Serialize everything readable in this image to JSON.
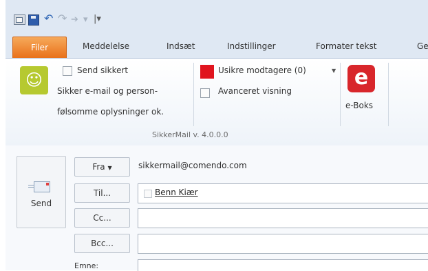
{
  "quick_access": {
    "icons": [
      "open-icon",
      "save-icon",
      "undo-icon",
      "redo-icon",
      "up-arrow-icon",
      "down-arrow-icon",
      "customize-toolbar-icon"
    ]
  },
  "tabs": {
    "file": "Filer",
    "message": "Meddelelse",
    "insert": "Indsæt",
    "options": "Indstillinger",
    "format": "Formater tekst",
    "review_truncated": "Ge"
  },
  "sikkermail": {
    "send_secure": "Send sikkert",
    "line1": "Sikker e-mail og person-",
    "line2": "følsomme oplysninger ok.",
    "unsafe_recipients": "Usikre modtagere (0)",
    "advanced_view": "Avanceret visning",
    "eboks_icon": "e",
    "eboks_label": "e-Boks",
    "group_label": "SikkerMail v. 4.0.0.0",
    "accent_colors": {
      "smiley": "#b6c930",
      "unsafe": "#e0141e",
      "eboks": "#d8262b",
      "file_tab": "#e9711a"
    }
  },
  "compose": {
    "send_label": "Send",
    "from_button": "Fra",
    "from_value": "sikkermail@comendo.com",
    "to_button": "Til...",
    "to_recipient": "Benn Kiær",
    "cc_button": "Cc...",
    "bcc_button": "Bcc...",
    "subject_label": "Emne:"
  }
}
